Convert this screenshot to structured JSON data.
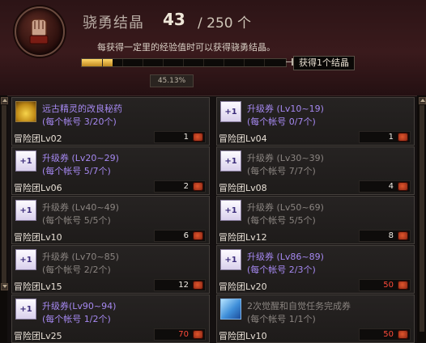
{
  "header": {
    "title": "骁勇结晶",
    "current": "43",
    "separator_total": "/ 250 个",
    "description": "每获得一定里的经验值时可以获得骁勇结晶。",
    "progress": 0.1513,
    "progress_label": "45.13%",
    "reward_tip": "获得1个结晶",
    "emblem_icon": "fist-emblem-icon"
  },
  "cards": [
    {
      "name": "远古精灵的改良秘药",
      "sub": "(每个帐号 3/20个)",
      "level": "冒险团Lv02",
      "qty": "1",
      "qty_color": "white",
      "state": "active",
      "icon": "potion-icon"
    },
    {
      "name": "升级券 (Lv10~19)",
      "sub": "(每个帐号 0/7个)",
      "level": "冒险团Lv04",
      "qty": "1",
      "qty_color": "white",
      "state": "active",
      "icon": "level-up-ticket-icon"
    },
    {
      "name": "升级券 (Lv20~29)",
      "sub": "(每个帐号 5/7个)",
      "level": "冒险团Lv06",
      "qty": "2",
      "qty_color": "white",
      "state": "active",
      "icon": "level-up-ticket-icon"
    },
    {
      "name": "升级券 (Lv30~39)",
      "sub": "(每个帐号 7/7个)",
      "level": "冒险团Lv08",
      "qty": "4",
      "qty_color": "white",
      "state": "inactive",
      "icon": "level-up-ticket-icon"
    },
    {
      "name": "升级券 (Lv40~49)",
      "sub": "(每个帐号 5/5个)",
      "level": "冒险团Lv10",
      "qty": "6",
      "qty_color": "white",
      "state": "inactive",
      "icon": "level-up-ticket-icon"
    },
    {
      "name": "升级券 (Lv50~69)",
      "sub": "(每个帐号 5/5个)",
      "level": "冒险团Lv12",
      "qty": "8",
      "qty_color": "white",
      "state": "inactive",
      "icon": "level-up-ticket-icon"
    },
    {
      "name": "升级券 (Lv70~85)",
      "sub": "(每个帐号 2/2个)",
      "level": "冒险团Lv15",
      "qty": "12",
      "qty_color": "white",
      "state": "inactive",
      "icon": "level-up-ticket-icon"
    },
    {
      "name": "升级券 (Lv86~89)",
      "sub": "(每个帐号 2/3个)",
      "level": "冒险团Lv20",
      "qty": "50",
      "qty_color": "red",
      "state": "active",
      "icon": "level-up-ticket-icon"
    },
    {
      "name": "升级券(Lv90~94)",
      "sub": "(每个帐号 1/2个)",
      "level": "冒险团Lv25",
      "qty": "70",
      "qty_color": "red",
      "state": "active",
      "icon": "level-up-ticket-icon"
    },
    {
      "name": "2次觉醒和自觉任务完成券",
      "sub": "(每个帐号 1/1个)",
      "level": "冒险团Lv10",
      "qty": "50",
      "qty_color": "red",
      "state": "inactive",
      "icon": "awakening-book-icon"
    }
  ]
}
